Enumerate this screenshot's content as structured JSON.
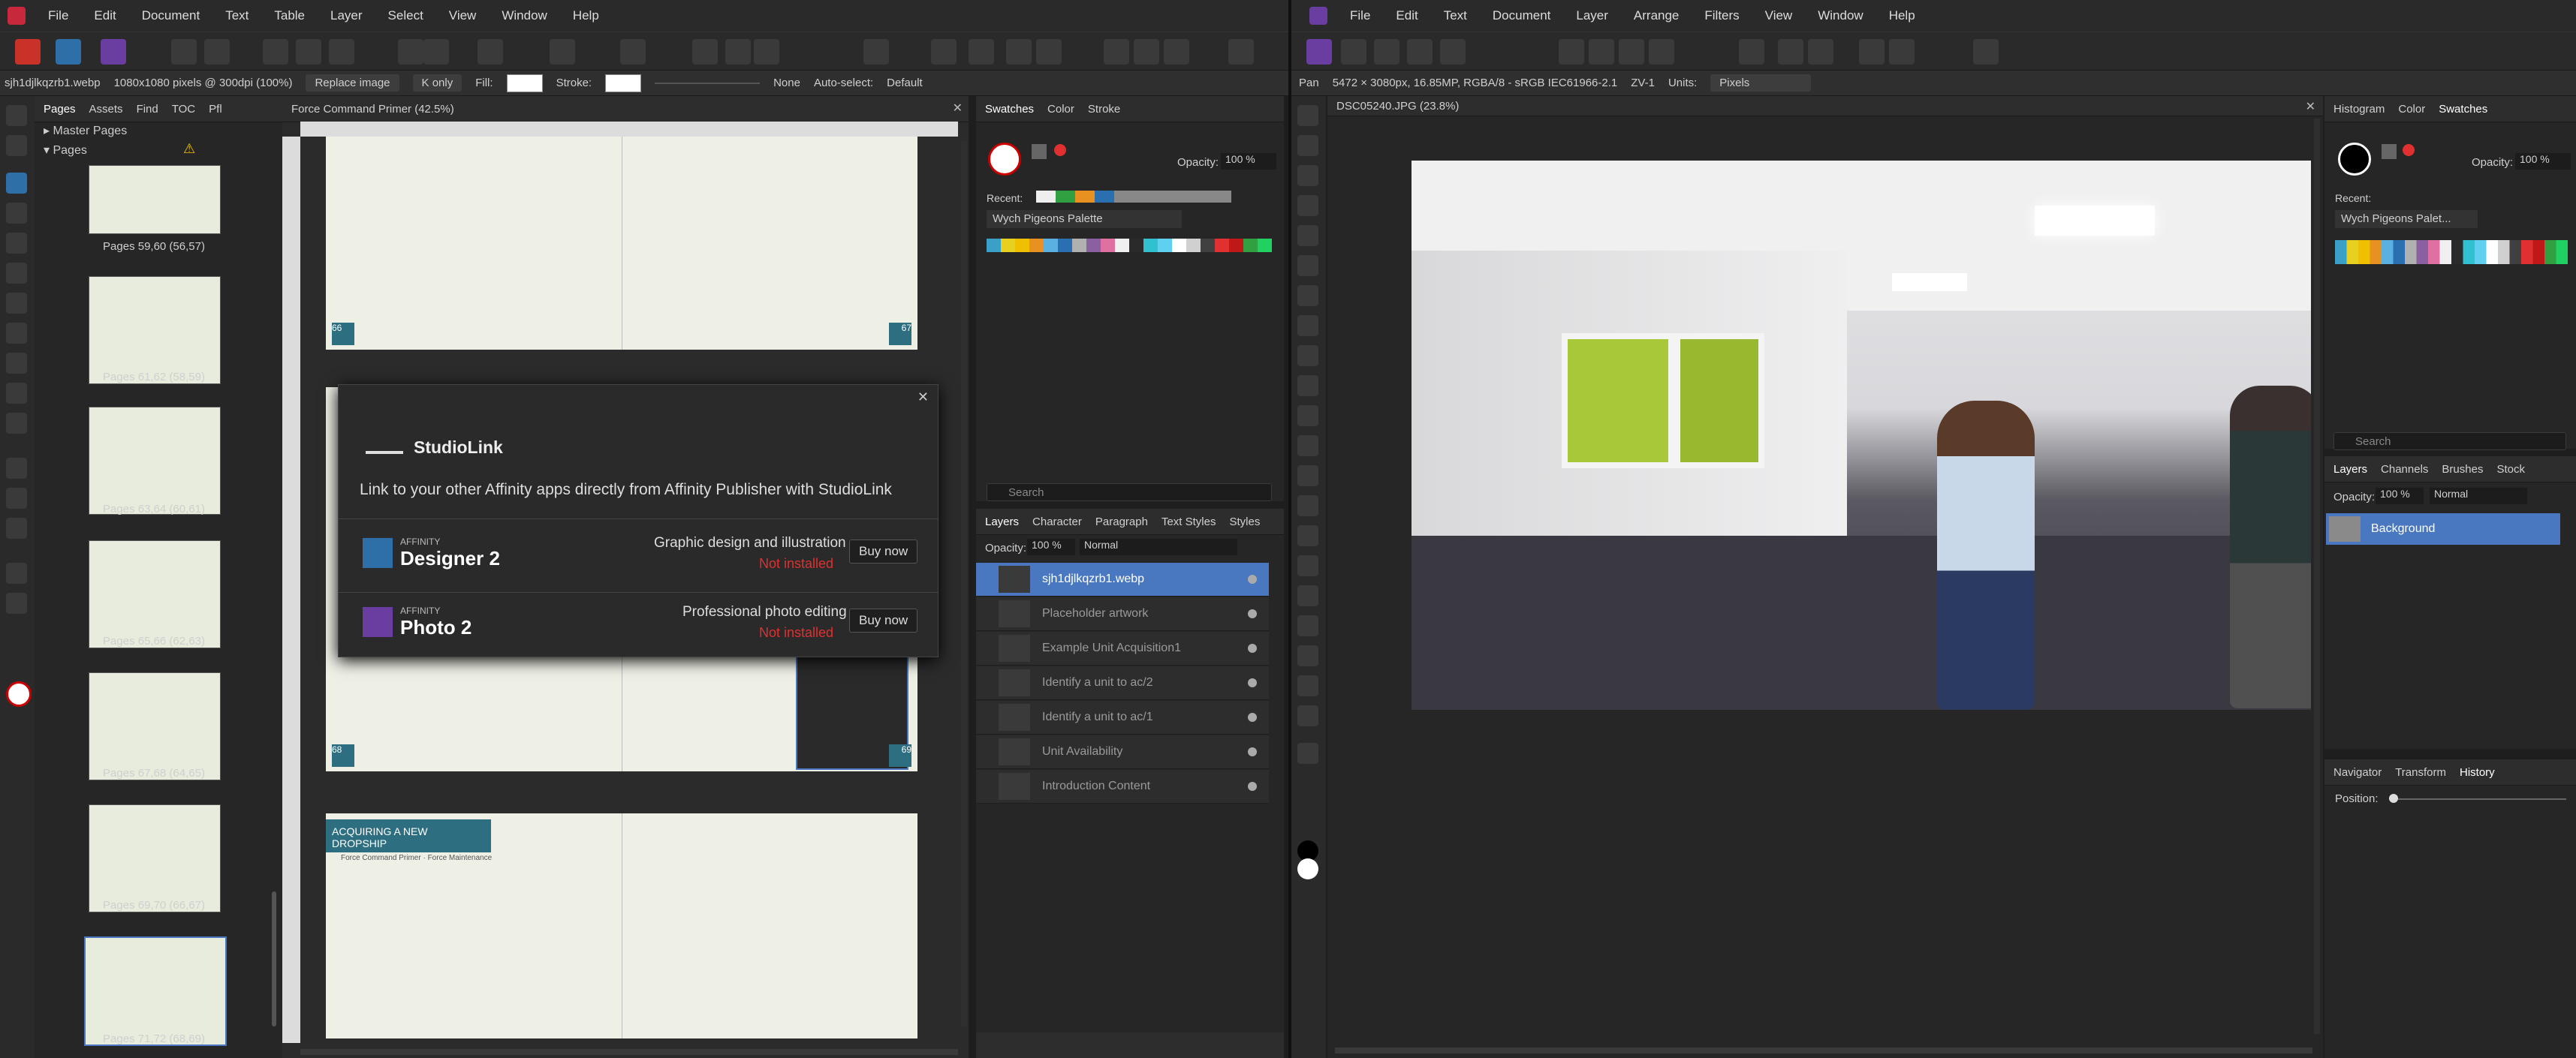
{
  "publisher": {
    "menu": [
      "File",
      "Edit",
      "Document",
      "Text",
      "Table",
      "Layer",
      "Select",
      "View",
      "Window",
      "Help"
    ],
    "context": {
      "filename": "sjh1djlkqzrb1.webp",
      "dims": "1080x1080 pixels @ 300dpi (100%)",
      "replace": "Replace image",
      "konly": "K only",
      "fill": "Fill:",
      "stroke": "Stroke:",
      "none": "None",
      "autoselect": "Auto-select:",
      "autoselect_value": "Default"
    },
    "pages_panel": {
      "tabs": [
        "Pages",
        "Assets",
        "Find",
        "TOC",
        "Pfl"
      ],
      "master_pages": "Master Pages",
      "pages": "Pages",
      "labels": [
        "Pages 59,60 (56,57)",
        "Pages 61,62 (58,59)",
        "Pages 63,64 (60,61)",
        "Pages 65,66 (62,63)",
        "Pages 67,68 (64,65)",
        "Pages 69,70 (66,67)",
        "Pages 71,72 (68,69)"
      ]
    },
    "document": {
      "title": "Force Command Primer (42.5%)",
      "spread_heading": "ACQUIRING A NEW DROPSHIP",
      "spread_sub": "Force Command Primer · Force Maintenance",
      "page_left": "66",
      "page_right": "67",
      "page_left2": "68",
      "page_right2": "69"
    },
    "studiolink": {
      "brand": "StudioLink",
      "tagline": "Link to your other Affinity apps directly from Affinity Publisher with StudioLink",
      "apps": [
        {
          "small": "AFFINITY",
          "name": "Designer 2",
          "desc": "Graphic design and illustration",
          "status": "Not installed",
          "button": "Buy now"
        },
        {
          "small": "AFFINITY",
          "name": "Photo 2",
          "desc": "Professional photo editing",
          "status": "Not installed",
          "button": "Buy now"
        }
      ]
    },
    "swatches_panel": {
      "tabs": [
        "Swatches",
        "Color",
        "Stroke"
      ],
      "opacity_label": "Opacity:",
      "opacity": "100 %",
      "recent": "Recent:",
      "palette": "Wych Pigeons Palette",
      "search": "Search"
    },
    "layers_panel": {
      "tabs": [
        "Layers",
        "Character",
        "Paragraph",
        "Text Styles",
        "Styles"
      ],
      "opacity_label": "Opacity:",
      "opacity": "100 %",
      "blend": "Normal",
      "layers": [
        "sjh1djlkqzrb1.webp",
        "Placeholder artwork",
        "Example Unit Acquisition1",
        "Identify a unit to ac/2",
        "Identify a unit to ac/1",
        "Unit Availability",
        "Introduction Content"
      ]
    }
  },
  "photo": {
    "menu": [
      "File",
      "Edit",
      "Text",
      "Document",
      "Layer",
      "Arrange",
      "Filters",
      "View",
      "Window",
      "Help"
    ],
    "context": {
      "tool": "Pan",
      "info": "5472 × 3080px, 16.85MP, RGBA/8 - sRGB IEC61966-2.1",
      "zv": "ZV-1",
      "units_label": "Units:",
      "units": "Pixels"
    },
    "document": {
      "title": "DSC05240.JPG (23.8%)"
    },
    "right_panel": {
      "tabs": [
        "Histogram",
        "Color",
        "Swatches"
      ],
      "opacity_label": "Opacity:",
      "opacity": "100 %",
      "recent": "Recent:",
      "palette": "Wych Pigeons Palet...",
      "search": "Search",
      "layer_tabs": [
        "Layers",
        "Channels",
        "Brushes",
        "Stock"
      ],
      "layer_opacity": "100 %",
      "blend": "Normal",
      "layer": "Background",
      "bottom_tabs": [
        "Navigator",
        "Transform",
        "History"
      ],
      "position": "Position:"
    }
  },
  "colors": {
    "accent": "#4a78c0",
    "palette": [
      "#3aa0c8",
      "#e8d020",
      "#f0c000",
      "#e89020",
      "#5ab0e0",
      "#2a70b0",
      "#b0b0b0",
      "#8a60a0",
      "#e070a0",
      "#f0f0f0",
      "#2a2a2a",
      "#30c0d0",
      "#60d0f0",
      "#ffffff",
      "#d0d0d0",
      "#404040",
      "#e03030",
      "#c01818",
      "#30a040",
      "#20d060"
    ]
  }
}
